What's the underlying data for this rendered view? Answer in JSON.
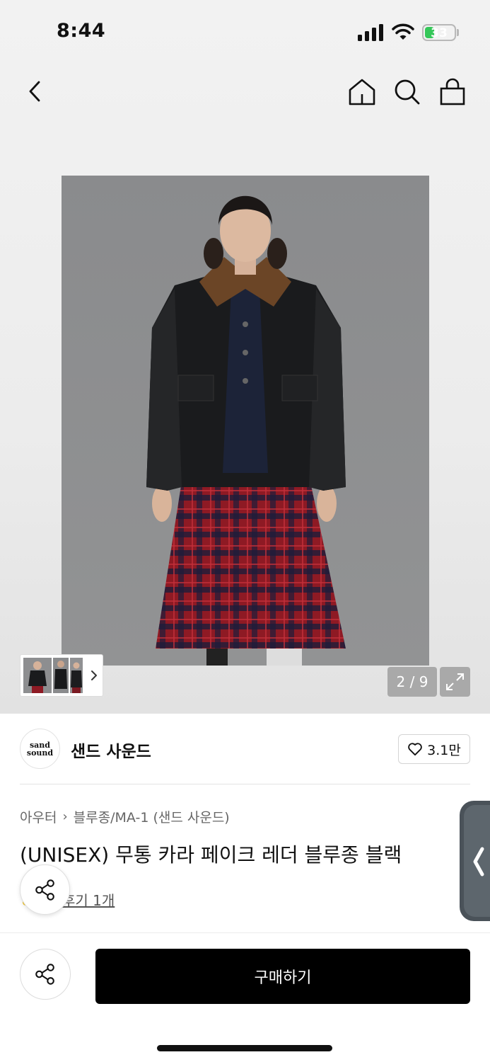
{
  "status_bar": {
    "time": "8:44",
    "battery": "33",
    "battery_level": 0.33
  },
  "nav": {
    "back_icon": "chevron-left-icon",
    "home_icon": "home-icon",
    "search_icon": "search-icon",
    "bag_icon": "shopping-bag-icon"
  },
  "gallery": {
    "counter": "2 / 9",
    "expand_icon": "expand-icon",
    "thumb_arrow_icon": "chevron-right-icon"
  },
  "brand": {
    "logo_top": "sand",
    "logo_bottom": "sound",
    "name": "샌드 사운드"
  },
  "like": {
    "count": "3.1만",
    "icon": "heart-icon"
  },
  "breadcrumb": {
    "category": "아우터",
    "subcategory": "블루종/MA-1 (샌드 사운드)"
  },
  "product": {
    "title": "(UNISEX) 무통 카라 페이크 레더 블루종 블랙",
    "review_link": "후기 1개"
  },
  "actions": {
    "buy_label": "구매하기",
    "share_icon": "share-icon"
  },
  "colors": {
    "buy_button": "#000000",
    "battery": "#35c759",
    "like_border": "#d4d4d4"
  }
}
